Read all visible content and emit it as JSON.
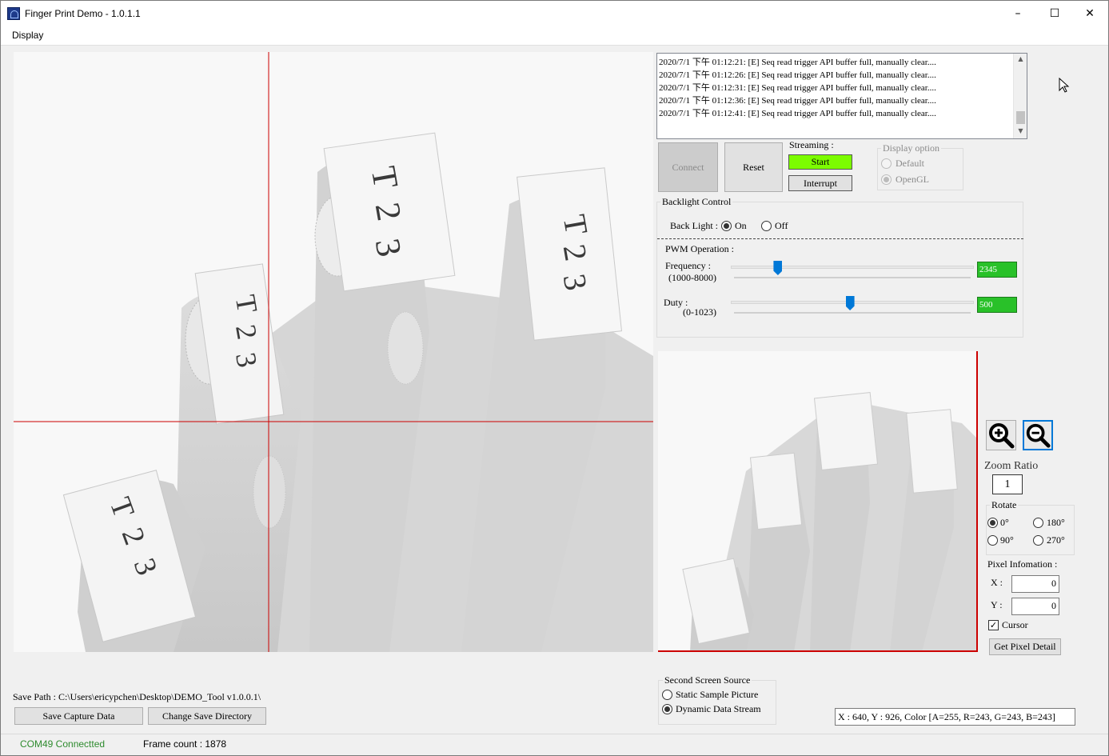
{
  "window": {
    "title": "Finger Print Demo - 1.0.1.1"
  },
  "titlebar": {
    "minimize_icon": "minimize-icon",
    "maximize_icon": "maximize-icon",
    "close_icon": "close-icon"
  },
  "menu": {
    "display": "Display"
  },
  "log": {
    "lines": [
      "2020/7/1 下午 01:12:21: [E] Seq read trigger API buffer full, manually clear....",
      "2020/7/1 下午 01:12:26: [E] Seq read trigger API buffer full, manually clear....",
      "2020/7/1 下午 01:12:31: [E] Seq read trigger API buffer full, manually clear....",
      "2020/7/1 下午 01:12:36: [E] Seq read trigger API buffer full, manually clear....",
      "2020/7/1 下午 01:12:41: [E] Seq read trigger API buffer full, manually clear...."
    ]
  },
  "controls": {
    "connect": "Connect",
    "reset": "Reset",
    "streaming_label": "Streaming :",
    "start": "Start",
    "interrupt": "Interrupt",
    "start_color": "#7cfc00"
  },
  "display_option": {
    "title": "Display option",
    "default": "Default",
    "opengl": "OpenGL",
    "selected": "OpenGL"
  },
  "backlight": {
    "title": "Backlight Control",
    "label": "Back Light :",
    "on": "On",
    "off": "Off",
    "selected": "On"
  },
  "pwm": {
    "title": "PWM Operation :",
    "frequency_label": "Frequency :",
    "frequency_range": "(1000-8000)",
    "frequency_value": "2345",
    "frequency_num": 2345,
    "frequency_min": 1000,
    "frequency_max": 8000,
    "duty_label": "Duty :",
    "duty_range": "(0-1023)",
    "duty_value": "500",
    "duty_num": 500,
    "duty_min": 0,
    "duty_max": 1023,
    "value_color": "#29c129"
  },
  "zoom": {
    "in_icon": "zoom-in-icon",
    "out_icon": "zoom-out-icon",
    "ratio_label": "Zoom Ratio",
    "ratio_value": "1"
  },
  "rotate": {
    "title": "Rotate",
    "r0": "0°",
    "r90": "90°",
    "r180": "180°",
    "r270": "270°",
    "selected": "0°"
  },
  "pixel": {
    "title": "Pixel Infomation :",
    "x_label": "X :",
    "y_label": "Y :",
    "x_value": "0",
    "y_value": "0",
    "cursor_label": "Cursor",
    "cursor_checked": true,
    "get_detail": "Get Pixel Detail"
  },
  "save": {
    "path_label": "Save Path : C:\\Users\\ericypchen\\Desktop\\DEMO_Tool v1.0.0.1\\",
    "save_capture": "Save Capture Data",
    "change_dir": "Change Save Directory"
  },
  "second_screen": {
    "title": "Second Screen Source",
    "static": "Static Sample Picture",
    "dynamic": "Dynamic Data Stream",
    "selected": "Dynamic Data Stream"
  },
  "pixel_readout": "X : 640, Y : 926, Color [A=255, R=243, G=243, B=243]",
  "status": {
    "com": "COM49 Connectted",
    "com_color": "#2e8b2e",
    "frame": "Frame count : 1878"
  },
  "image": {
    "labels": [
      "T",
      "2",
      "3",
      "T",
      "2",
      "3",
      "T",
      "2",
      "3",
      "T",
      "2",
      "3"
    ],
    "crosshair_color": "#cc0000"
  }
}
